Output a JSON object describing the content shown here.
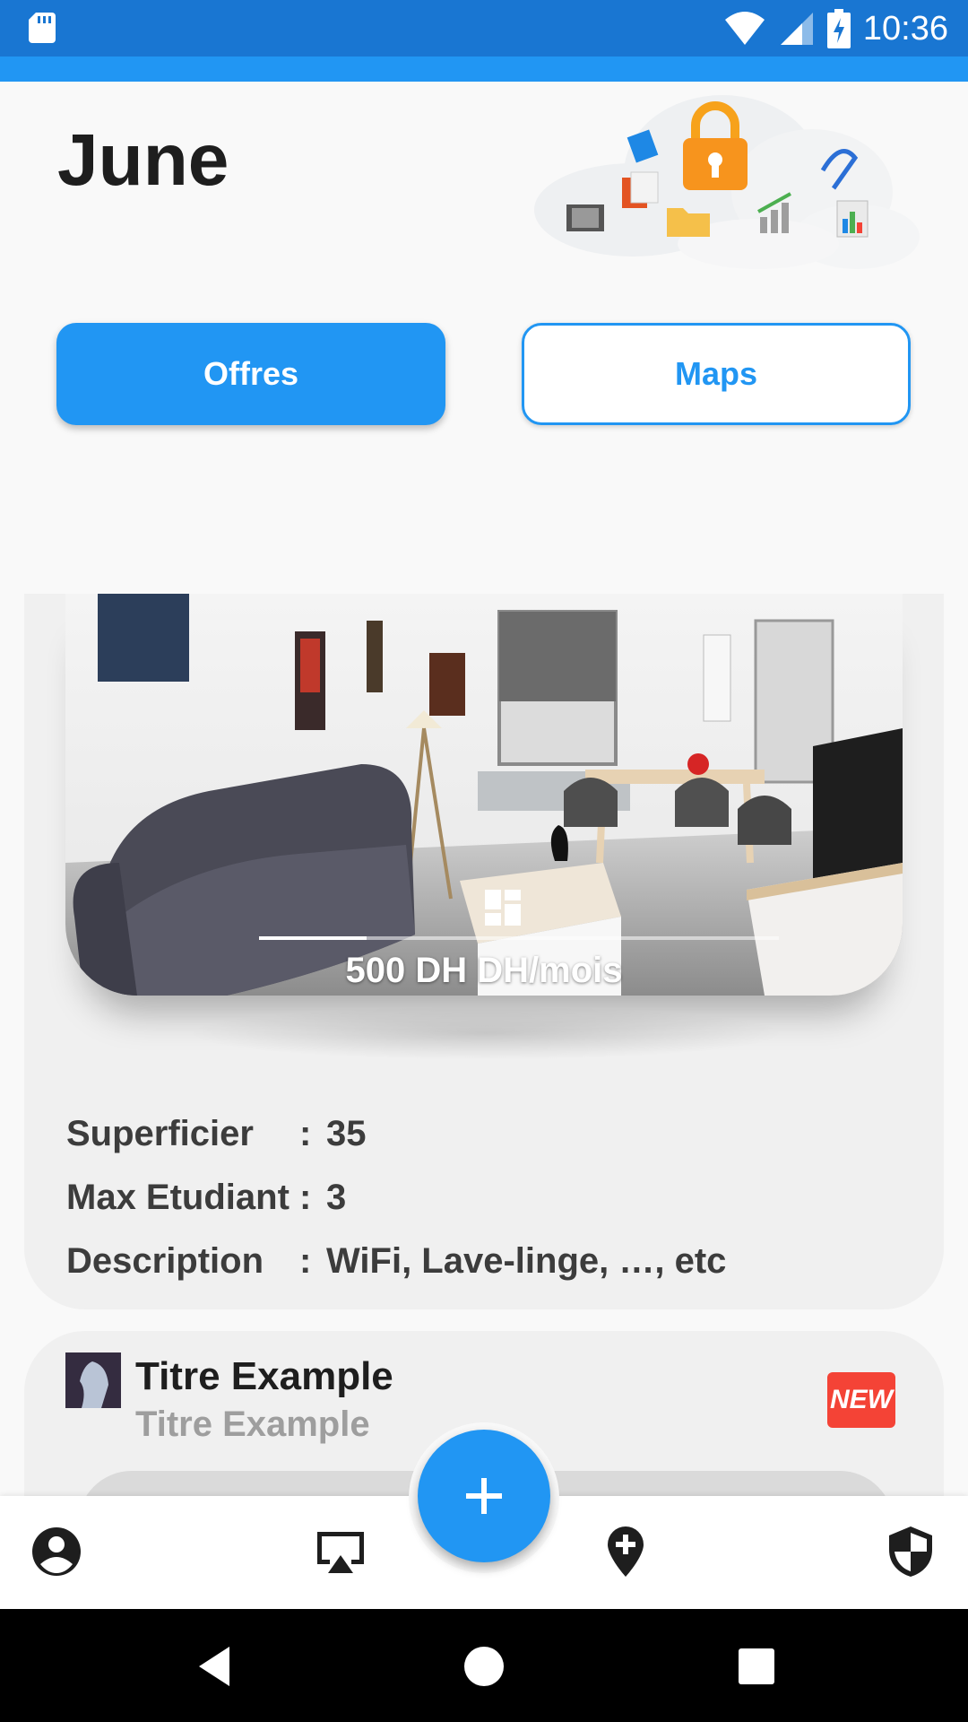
{
  "status_bar": {
    "time": "10:36",
    "icons": [
      "sd-card-icon",
      "wifi-icon",
      "signal-icon",
      "battery-charging-icon"
    ]
  },
  "header": {
    "title": "June",
    "illustration": "cloud-storage-lock-icon"
  },
  "tabs": {
    "offres_label": "Offres",
    "maps_label": "Maps"
  },
  "colors": {
    "primary": "#2196f3",
    "status_bar": "#1976d2",
    "badge": "#f44336"
  },
  "listing": {
    "price": "500 DH DH/mois",
    "fields": [
      {
        "label": "Superficier",
        "sep": ":",
        "value": "35"
      },
      {
        "label": "Max Etudiant",
        "sep": ":",
        "value": "3"
      },
      {
        "label": "Description",
        "sep": ":",
        "value": "WiFi, Lave-linge, …, etc"
      }
    ]
  },
  "listing2": {
    "title": "Titre Example",
    "subtitle": "Titre Example",
    "badge": "NEW"
  },
  "bottom_nav": {
    "items": [
      "account-icon",
      "cast-icon",
      "add-location-icon",
      "shield-icon"
    ],
    "fab": "add-icon"
  },
  "system_nav": [
    "back-icon",
    "home-icon",
    "recents-icon"
  ]
}
